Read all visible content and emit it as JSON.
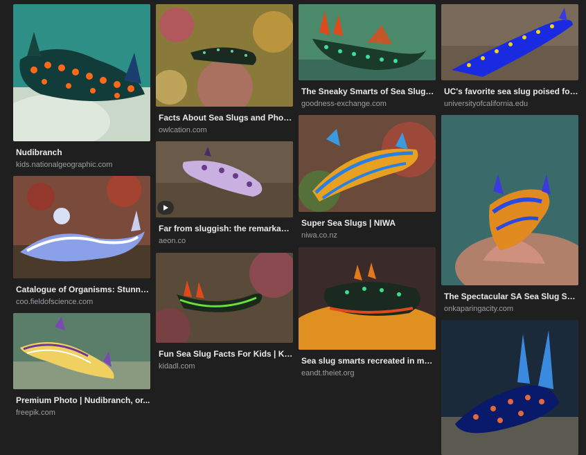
{
  "results": [
    {
      "title": "Nudibranch",
      "source": "kids.nationalgeographic.com",
      "image_alt": "teal and orange spotted sea slug"
    },
    {
      "title": "Catalogue of Organisms: Stunnin...",
      "source": "coo.fieldofscience.com",
      "image_alt": "blue and white sea slug"
    },
    {
      "title": "Premium Photo | Nudibranch, or...",
      "source": "freepik.com",
      "image_alt": "yellow and purple striped sea slug"
    },
    {
      "title": "Facts About Sea Slugs and Phot...",
      "source": "owlcation.com",
      "image_alt": "dark sea slug on coral"
    },
    {
      "title": "Far from sluggish: the remarkabl...",
      "source": "aeon.co",
      "image_alt": "purple and white sea slug"
    },
    {
      "title": "Fun Sea Slug Facts For Kids | Kid...",
      "source": "kidadl.com",
      "image_alt": "green and black sea slug"
    },
    {
      "title": "The Sneaky Smarts of Sea Slugs ...",
      "source": "goodness-exchange.com",
      "image_alt": "green and orange sea slug"
    },
    {
      "title": "Super Sea Slugs | NIWA",
      "source": "niwa.co.nz",
      "image_alt": "blue and orange sea slug"
    },
    {
      "title": "Sea slug smarts recreated in ma...",
      "source": "eandt.theiet.org",
      "image_alt": "dark green sea slug on orange sponge"
    },
    {
      "title": "UC's favorite sea slug poised for ...",
      "source": "universityofcalifornia.edu",
      "image_alt": "blue and yellow sea slug"
    },
    {
      "title": "The Spectacular SA Sea Slug Sh...",
      "source": "onkaparingacity.com",
      "image_alt": "blue and orange sea slug on coral"
    },
    {
      "title": "",
      "source": "",
      "image_alt": "dark blue sea slug with orange spots"
    }
  ],
  "colors": {
    "background": "#1f1f1f",
    "title": "#e8eaed",
    "source": "#9aa0a6"
  }
}
